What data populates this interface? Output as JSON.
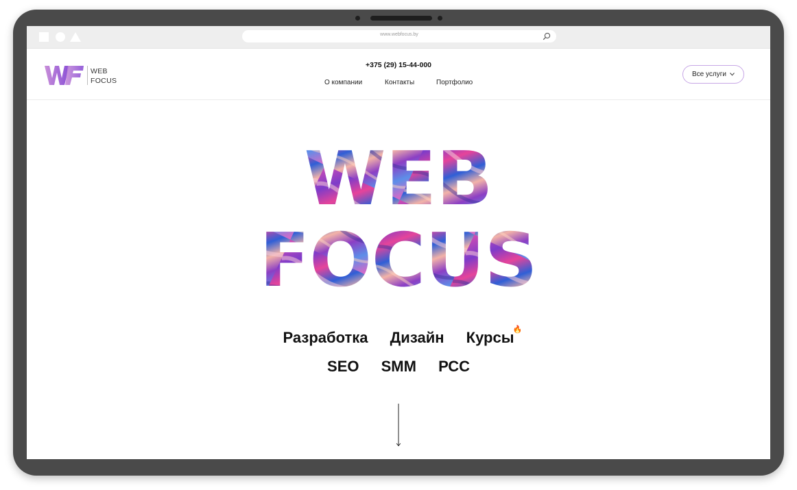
{
  "browser": {
    "url": "www.webfocus.by",
    "icons": [
      "square-icon",
      "circle-icon",
      "triangle-icon",
      "search-icon"
    ]
  },
  "header": {
    "logo_line1": "WEB",
    "logo_line2": "FOCUS",
    "phone": "+375 (29) 15-44-000",
    "nav": [
      {
        "label": "О компании"
      },
      {
        "label": "Контакты"
      },
      {
        "label": "Портфолио"
      }
    ],
    "services_button": "Все услуги"
  },
  "hero": {
    "line1": "WEB",
    "line2": "FOCUS"
  },
  "services": {
    "row1": [
      "Разработка",
      "Дизайн",
      "Курсы"
    ],
    "row2": [
      "SEO",
      "SMM",
      "РСС"
    ],
    "hot_badge_icon": "fire-icon"
  },
  "scroll_hint_icon": "arrow-down-icon",
  "colors": {
    "accent_purple": "#b985e0",
    "accent_pink": "#e0459f",
    "accent_blue": "#2f5fd6",
    "device_frame": "#4a4a4a"
  }
}
